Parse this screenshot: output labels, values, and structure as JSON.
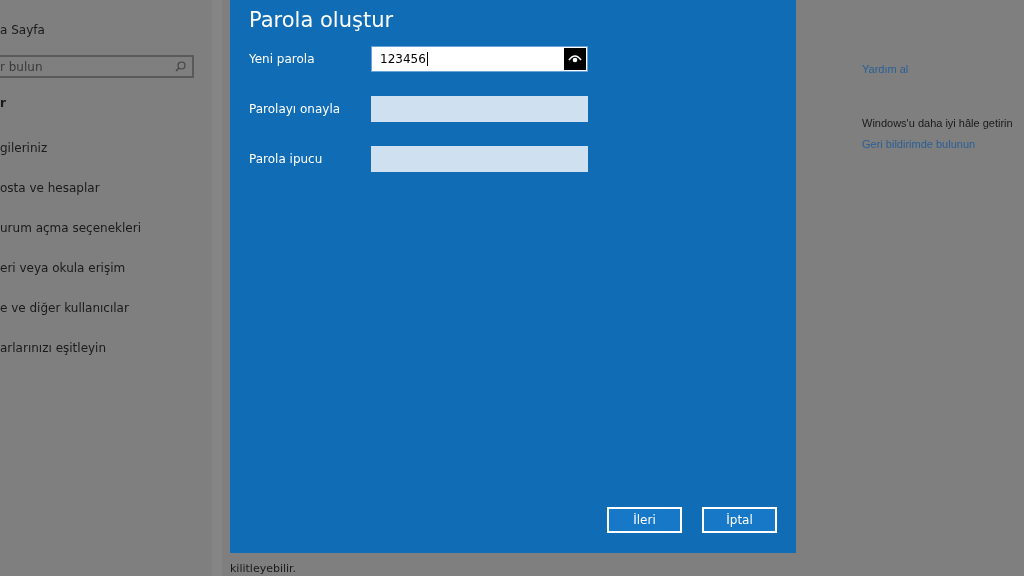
{
  "sidebar": {
    "home_label": "a Sayfa",
    "search": {
      "placeholder": "r bulun"
    },
    "section_heading": "r",
    "items": [
      {
        "label": "gileriniz"
      },
      {
        "label": "osta ve hesaplar"
      },
      {
        "label": "urum açma seçenekleri"
      },
      {
        "label": "eri veya okula erişim"
      },
      {
        "label": "e ve diğer kullanıcılar"
      },
      {
        "label": "arlarınızı eşitleyin"
      }
    ]
  },
  "background_text": "kilitleyebilir.",
  "right_panel": {
    "help_link": "Yardım al",
    "feedback_heading": "Windows'u daha iyi hâle getirin",
    "feedback_link": "Geri bildirimde bulunun"
  },
  "dialog": {
    "title": "Parola oluştur",
    "fields": [
      {
        "label": "Yeni parola",
        "value": "123456",
        "focused": true,
        "reveal_button": true
      },
      {
        "label": "Parolayı onayla",
        "focused": false,
        "reveal_button": false
      },
      {
        "label": "Parola ipucu",
        "focused": false,
        "reveal_button": false
      }
    ],
    "buttons": [
      "İleri",
      "İptal"
    ]
  }
}
